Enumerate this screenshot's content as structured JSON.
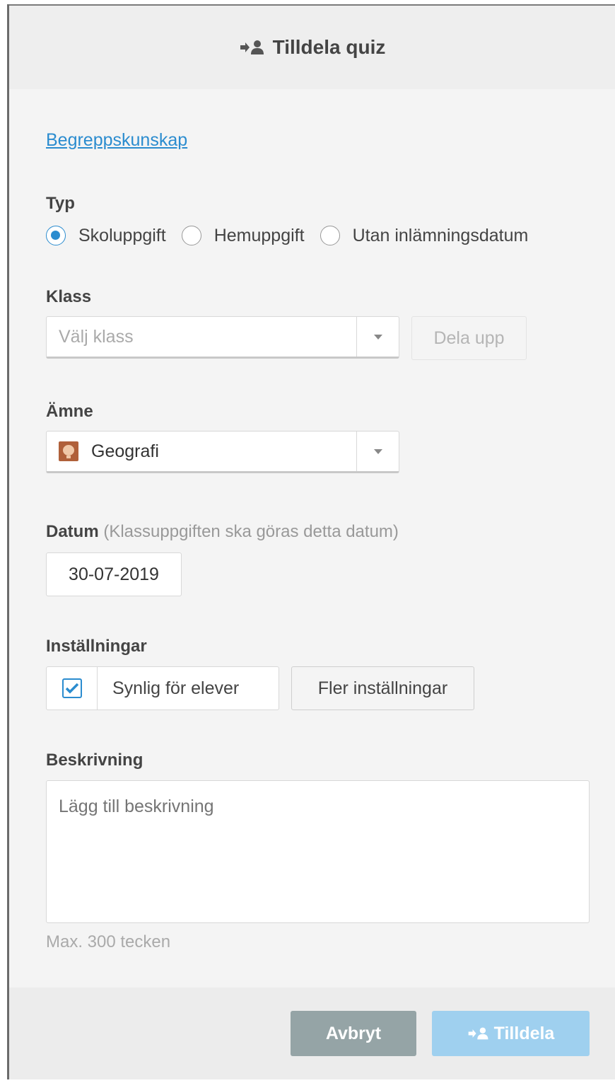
{
  "dialog": {
    "title": "Tilldela quiz",
    "title_icon": "assign-user-icon"
  },
  "quiz_link": "Begreppskunskap",
  "type": {
    "label": "Typ",
    "options": [
      "Skoluppgift",
      "Hemuppgift",
      "Utan inlämningsdatum"
    ],
    "selected": "Skoluppgift"
  },
  "class": {
    "label": "Klass",
    "placeholder": "Välj klass",
    "split_button": "Dela upp"
  },
  "subject": {
    "label": "Ämne",
    "value": "Geografi",
    "icon": "geography-subject-icon"
  },
  "date": {
    "label": "Datum",
    "hint": "(Klassuppgiften ska göras detta datum)",
    "value": "30-07-2019"
  },
  "settings": {
    "label": "Inställningar",
    "visible_label": "Synlig för elever",
    "visible_checked": true,
    "more_button": "Fler inställningar"
  },
  "description": {
    "label": "Beskrivning",
    "placeholder": "Lägg till beskrivning",
    "max_note": "Max. 300 tecken"
  },
  "footer": {
    "cancel": "Avbryt",
    "assign": "Tilldela"
  },
  "colors": {
    "accent": "#2b8ccf",
    "cancel_bg": "#95a4a6",
    "assign_bg": "#9fd0ef"
  }
}
